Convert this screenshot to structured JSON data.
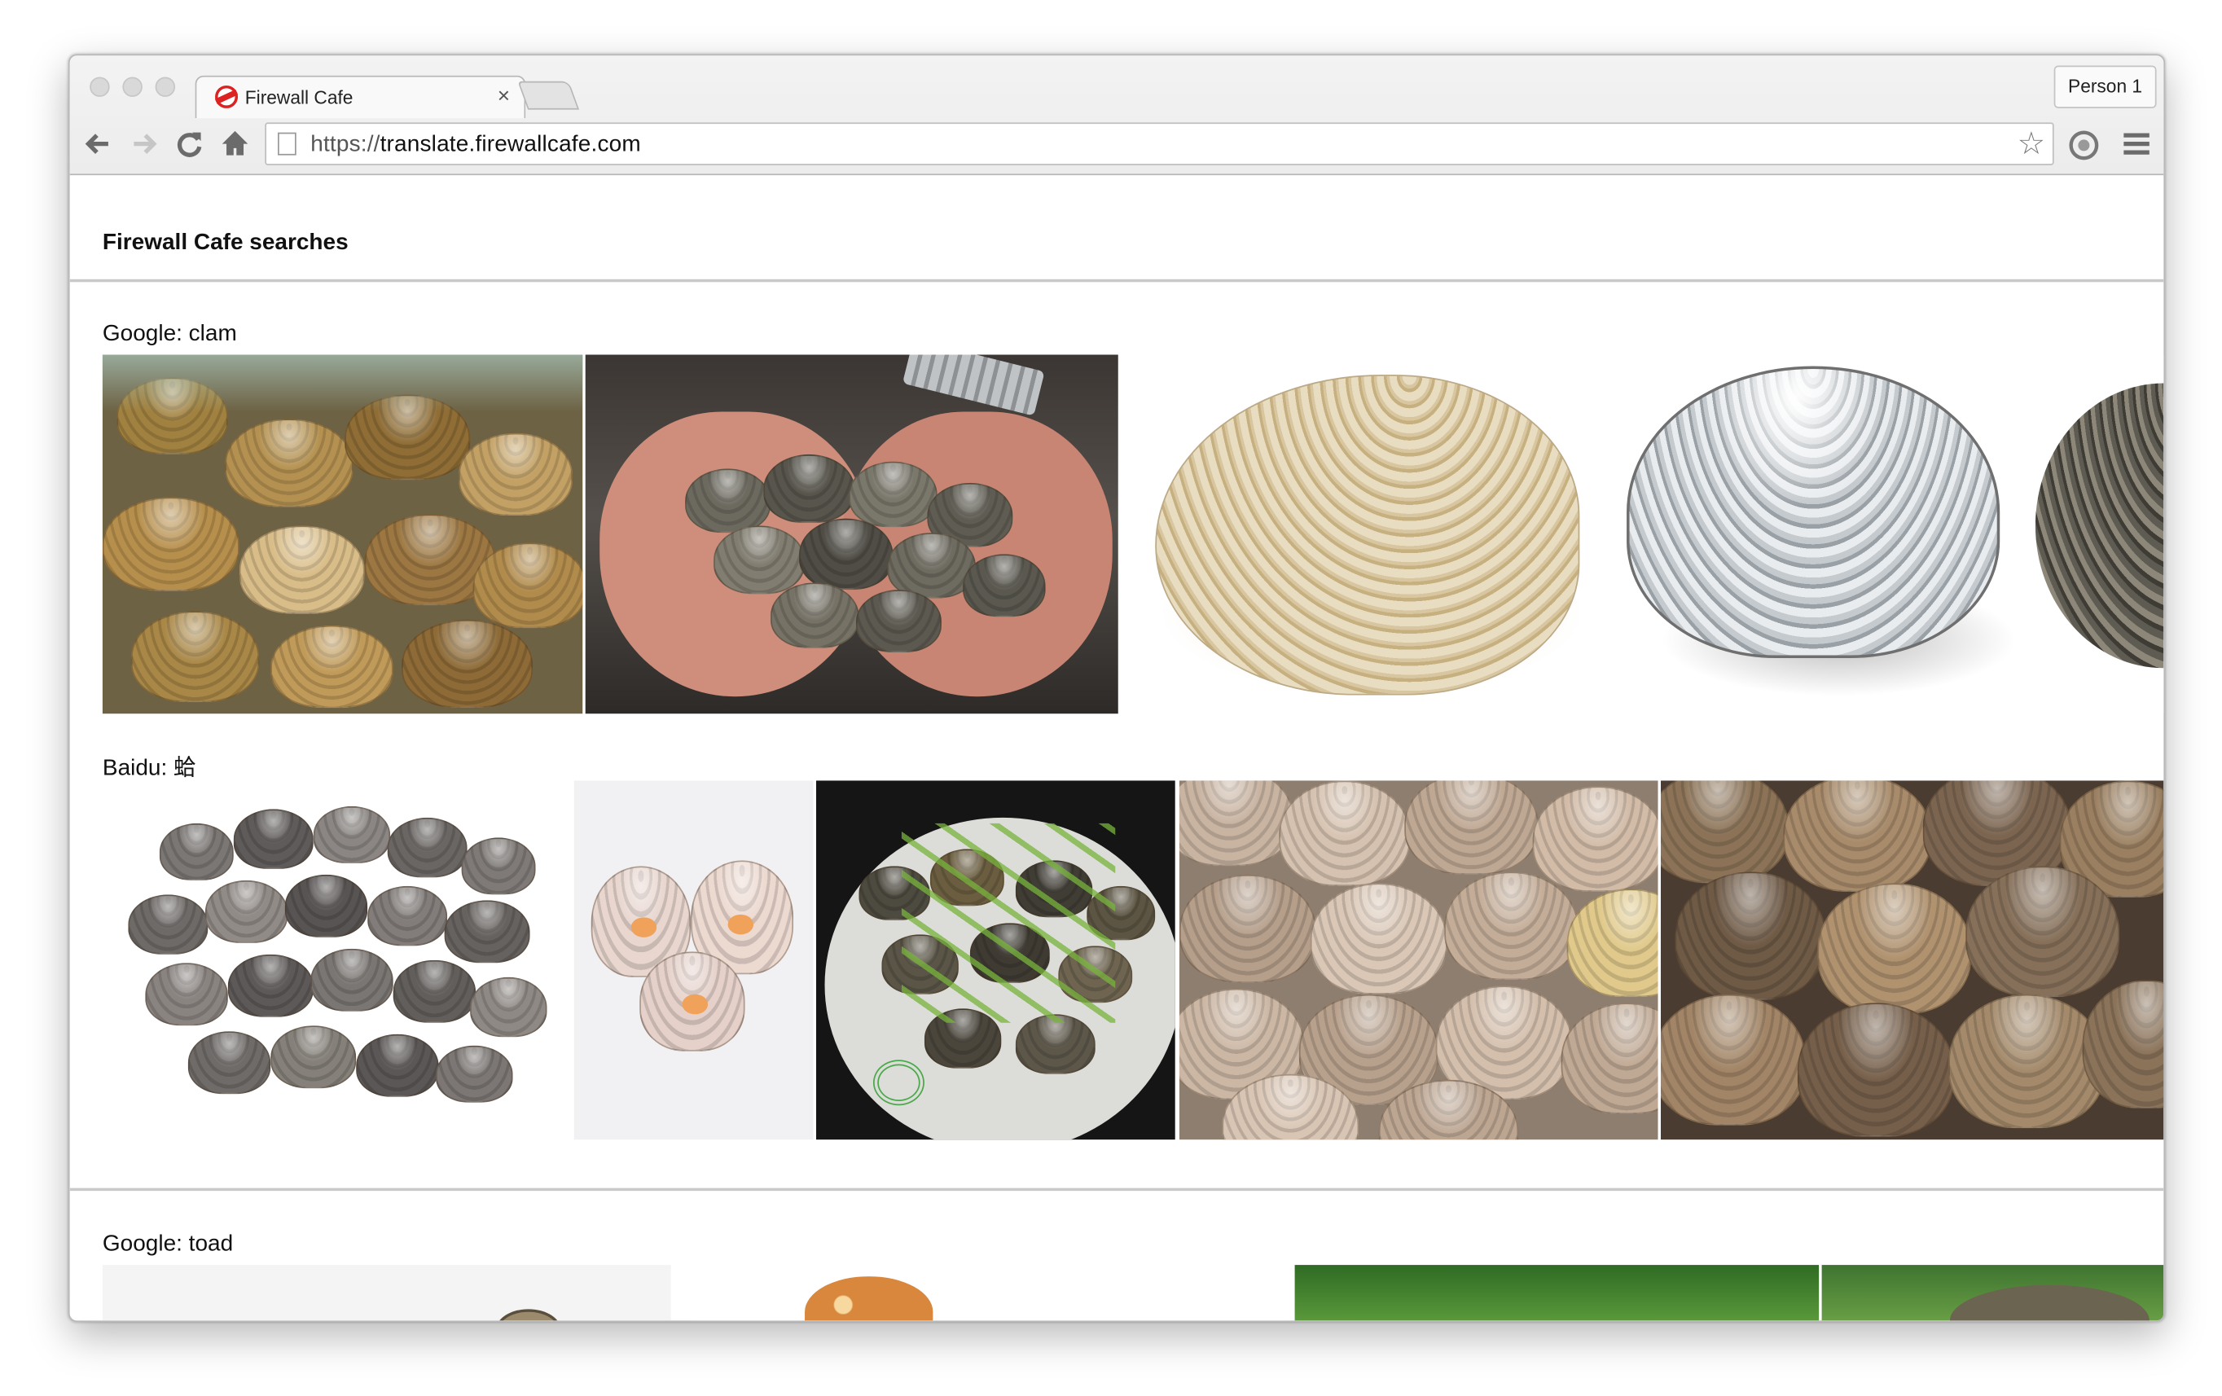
{
  "browser": {
    "tab_title": "Firewall Cafe",
    "tab_close": "×",
    "profile": "Person 1",
    "url_scheme": "https://",
    "url_host": "translate.firewallcafe.com"
  },
  "page": {
    "heading": "Firewall Cafe searches",
    "sections": [
      {
        "engine": "Google",
        "query": "clam",
        "label": "Google: clam"
      },
      {
        "engine": "Baidu",
        "query": "蛤",
        "label": "Baidu: 蛤"
      },
      {
        "engine": "Google",
        "query": "toad",
        "label": "Google: toad"
      }
    ]
  },
  "icons": [
    "back-icon",
    "forward-icon",
    "reload-icon",
    "home-icon",
    "page-icon",
    "star-icon",
    "extension-icon",
    "menu-icon"
  ],
  "colors": {
    "favicon_red": "#dd2222",
    "divider": "#c9c9c9",
    "chrome": "#ececec"
  }
}
